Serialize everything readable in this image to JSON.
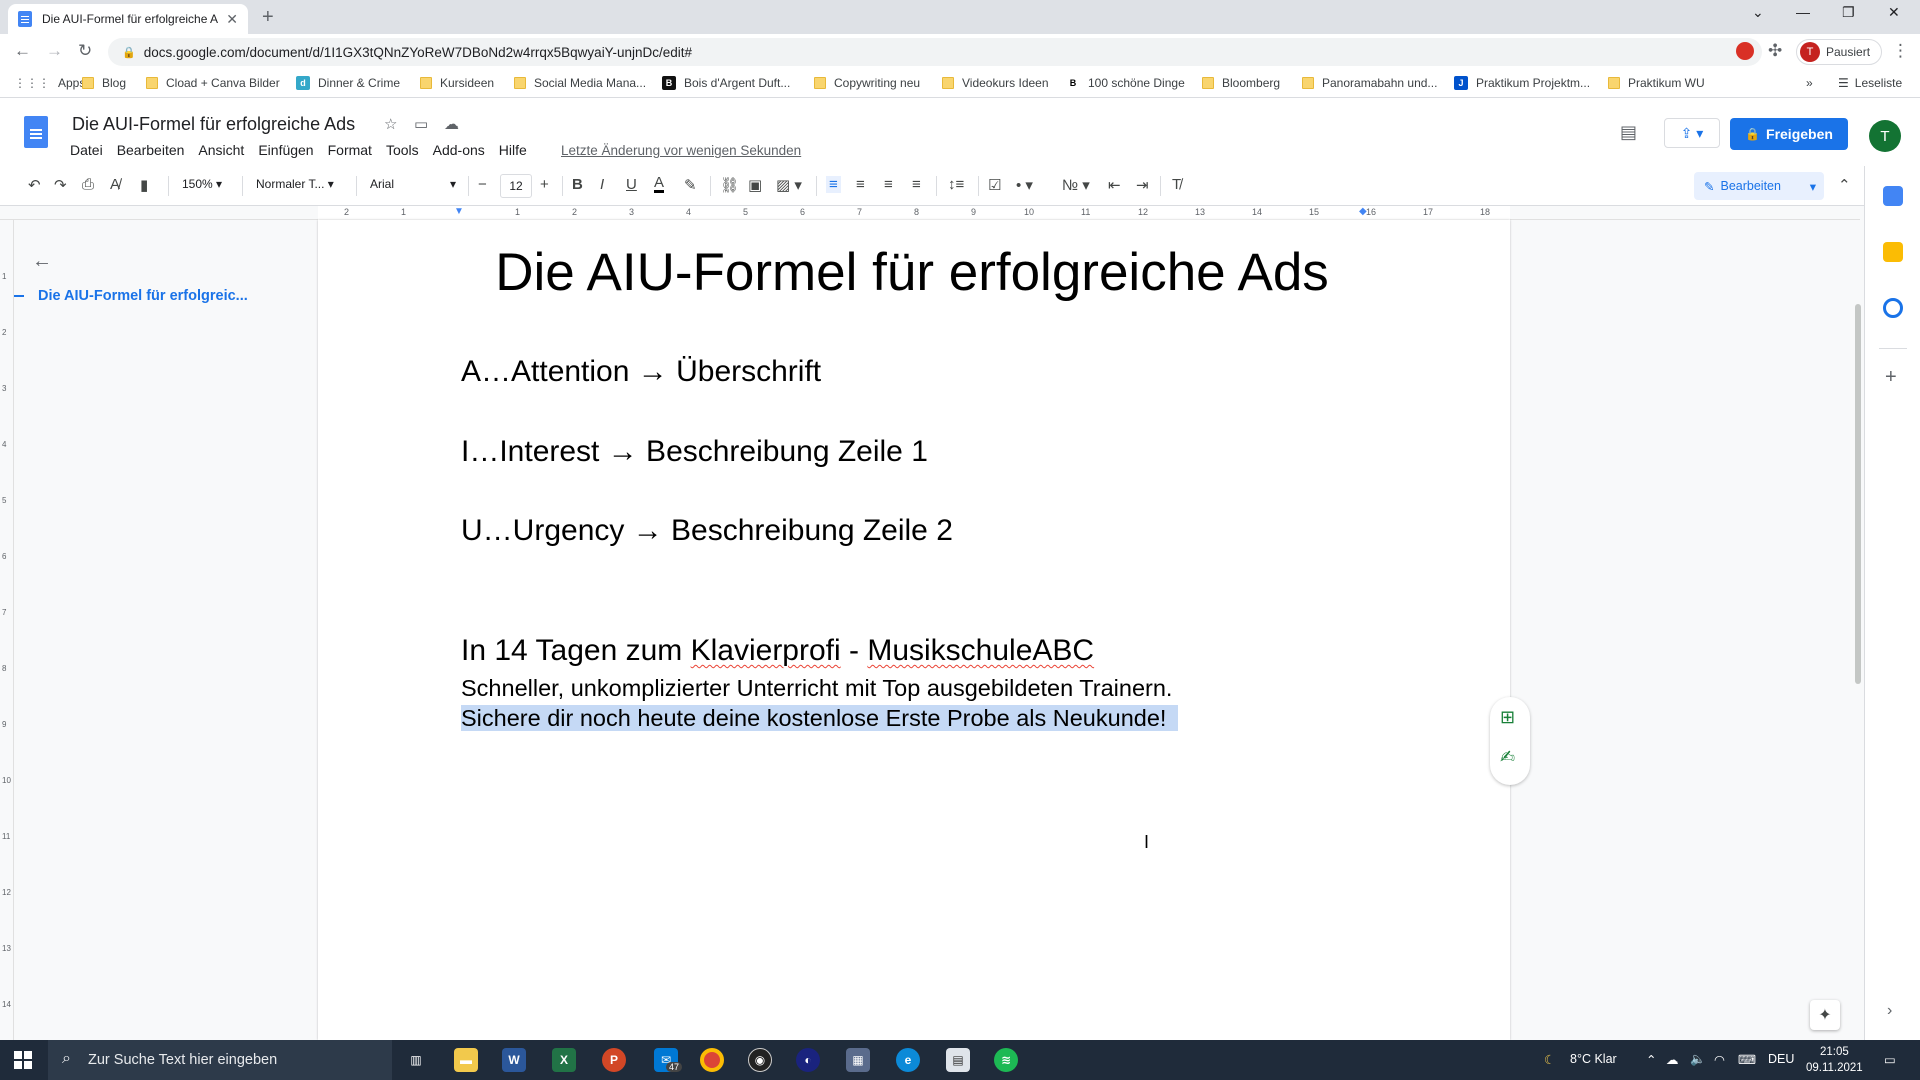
{
  "browser": {
    "tab_title": "Die AUI-Formel für erfolgreiche A",
    "url": "docs.google.com/document/d/1I1GX3tQNnZYoReW7DBoNd2w4rrqx5BqwyaiY-unjnDc/edit#",
    "profile_label": "Pausiert",
    "profile_initial": "T"
  },
  "bookmarks": [
    {
      "label": "Apps",
      "type": "apps"
    },
    {
      "label": "Blog",
      "type": "folder"
    },
    {
      "label": "Cload + Canva Bilder",
      "type": "folder"
    },
    {
      "label": "Dinner & Crime",
      "type": "site"
    },
    {
      "label": "Kursideen",
      "type": "folder"
    },
    {
      "label": "Social Media Mana...",
      "type": "folder"
    },
    {
      "label": "Bois d'Argent Duft...",
      "type": "site"
    },
    {
      "label": "Copywriting neu",
      "type": "folder"
    },
    {
      "label": "Videokurs Ideen",
      "type": "folder"
    },
    {
      "label": "100 schöne Dinge",
      "type": "site"
    },
    {
      "label": "Bloomberg",
      "type": "folder"
    },
    {
      "label": "Panoramabahn und...",
      "type": "folder"
    },
    {
      "label": "Praktikum Projektm...",
      "type": "site"
    },
    {
      "label": "Praktikum WU",
      "type": "folder"
    }
  ],
  "reading_list": "Leseliste",
  "docs": {
    "title": "Die AUI-Formel für erfolgreiche Ads",
    "menu": [
      "Datei",
      "Bearbeiten",
      "Ansicht",
      "Einfügen",
      "Format",
      "Tools",
      "Add-ons",
      "Hilfe"
    ],
    "last_edit": "Letzte Änderung vor wenigen Sekunden",
    "share_label": "Freigeben",
    "user_initial": "T"
  },
  "toolbar": {
    "zoom": "150%",
    "style": "Normaler T...",
    "font": "Arial",
    "font_size": "12",
    "mode": "Bearbeiten"
  },
  "ruler": {
    "horizontal": [
      "2",
      "1",
      "1",
      "2",
      "3",
      "4",
      "5",
      "6",
      "7",
      "8",
      "9",
      "10",
      "11",
      "12",
      "13",
      "14",
      "15",
      "16",
      "17",
      "18"
    ],
    "vertical": [
      "1",
      "2",
      "3",
      "4",
      "5",
      "6",
      "7",
      "8",
      "9",
      "10",
      "11",
      "12",
      "13",
      "14"
    ]
  },
  "outline": {
    "item": "Die AIU-Formel für erfolgreic..."
  },
  "document": {
    "heading": "Die AIU-Formel für erfolgreiche Ads",
    "line_a": "A…Attention → Überschrift",
    "line_i": "I…Interest → Beschreibung Zeile 1",
    "line_u": "U…Urgency → Beschreibung Zeile 2",
    "ad_headline_1": "In 14 Tagen zum ",
    "ad_headline_word1": "Klavierprofi",
    "ad_headline_2": " - ",
    "ad_headline_word2": "MusikschuleABC",
    "ad_line_1": "Schneller, unkomplizierter Unterricht mit Top ausgebildeten Trainern.",
    "ad_line_2": "Sichere dir noch heute deine kostenlose Erste Probe als Neukunde!"
  },
  "taskbar": {
    "search_placeholder": "Zur Suche Text hier eingeben",
    "mail_badge": "47",
    "weather": "8°C  Klar",
    "language": "DEU",
    "time": "21:05",
    "date": "09.11.2021"
  }
}
